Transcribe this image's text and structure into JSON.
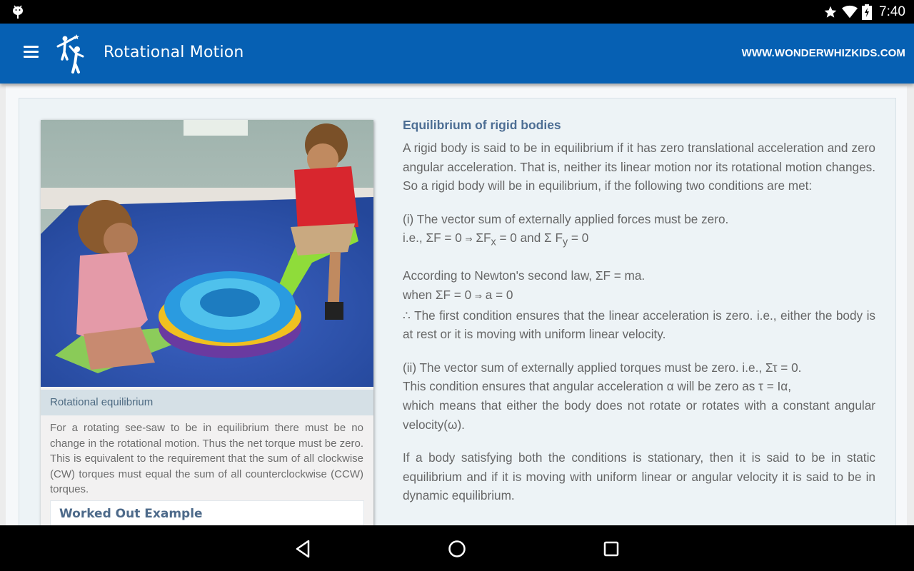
{
  "status_bar": {
    "time": "7:40",
    "icons": [
      "android-debug-icon",
      "star-icon",
      "wifi-icon",
      "battery-charging-icon"
    ]
  },
  "app_bar": {
    "title": "Rotational Motion",
    "website": "WWW.WONDERWHIZKIDS.COM",
    "colors": {
      "primary": "#0660b3"
    }
  },
  "figure": {
    "image_alt": "Two children playing on a spinning see-saw",
    "caption_title": "Rotational equilibrium",
    "caption_text": "For a rotating see-saw to be in equilibrium there must be no change in the rotational motion. Thus the net torque must be zero. This is equivalent to the requirement that the sum of all clockwise (CW) torques must equal the sum of all counterclockwise (CCW) torques.",
    "worked_example_label": "Worked Out Example"
  },
  "article": {
    "heading": "Equilibrium of rigid bodies",
    "intro": "A rigid body is said to be in equilibrium if it has zero translational acceleration and zero angular acceleration. That is, neither its linear motion nor its rotational motion changes. So a rigid body will be in equilibrium, if the following two conditions are met:",
    "condition1": {
      "statement": "(i) The vector sum of externally applied forces must be zero.",
      "eq_prefix": "i.e., ΣF = 0",
      "arrow": "⇒",
      "eq_fx": "ΣF",
      "eq_fx_sub": "x",
      "eq_mid": " = 0 and Σ F",
      "eq_fy_sub": "y",
      "eq_end": " = 0"
    },
    "newton": {
      "line1": "According to Newton's second law, ΣF = ma.",
      "line2_prefix": "when ΣF = 0",
      "arrow": "⇒",
      "line2_end": " a = 0",
      "line3": "∴ The first condition ensures that the linear acceleration is zero. i.e., either the body is at rest or it is moving with uniform linear velocity."
    },
    "condition2": {
      "line1": "(ii) The vector sum of externally applied torques must be zero. i.e., Στ = 0.",
      "line2": "This condition ensures that angular acceleration α will be zero as τ = Iα,",
      "line3": "which means that either the body does not rotate or rotates with a constant angular velocity(ω)."
    },
    "conclusion": "If a body satisfying both the conditions is stationary, then it is said to be in static equilibrium and if it is moving with uniform linear or angular velocity it is said to be in dynamic equilibrium."
  },
  "nav_bar": {
    "buttons": [
      "back",
      "home",
      "recents"
    ]
  }
}
